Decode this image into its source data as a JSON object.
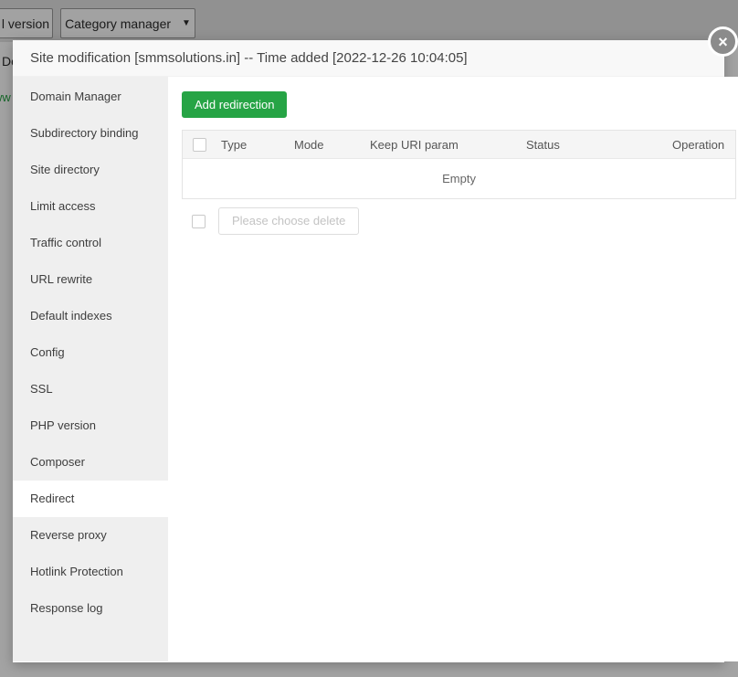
{
  "topbar": {
    "partial_button_label": "l version",
    "category_button_label": "Category manager"
  },
  "background_fragments": {
    "dark_text": "Do",
    "green_link_text": "ww"
  },
  "icons": {
    "caret_down": "▼",
    "close": "×"
  },
  "colors": {
    "accent_green": "#26a445",
    "sidebar_bg": "#efefef",
    "modal_header_bg": "#f8f8f8",
    "table_header_bg": "#f5f5f5",
    "overlay": "rgba(0,0,0,0.36)"
  },
  "modal": {
    "title": "Site modification [smmsolutions.in] -- Time added [2022-12-26 10:04:05]",
    "sidebar": {
      "items": [
        {
          "label": "Domain Manager",
          "active": false
        },
        {
          "label": "Subdirectory binding",
          "active": false
        },
        {
          "label": "Site directory",
          "active": false
        },
        {
          "label": "Limit access",
          "active": false
        },
        {
          "label": "Traffic control",
          "active": false
        },
        {
          "label": "URL rewrite",
          "active": false
        },
        {
          "label": "Default indexes",
          "active": false
        },
        {
          "label": "Config",
          "active": false
        },
        {
          "label": "SSL",
          "active": false
        },
        {
          "label": "PHP version",
          "active": false
        },
        {
          "label": "Composer",
          "active": false
        },
        {
          "label": "Redirect",
          "active": true
        },
        {
          "label": "Reverse proxy",
          "active": false
        },
        {
          "label": "Hotlink Protection",
          "active": false
        },
        {
          "label": "Response log",
          "active": false
        }
      ]
    },
    "content": {
      "add_button_label": "Add redirection",
      "table": {
        "columns": [
          "Type",
          "Mode",
          "Keep URI param",
          "Status",
          "Operation"
        ],
        "empty_text": "Empty"
      },
      "delete_button_label": "Please choose delete"
    }
  }
}
